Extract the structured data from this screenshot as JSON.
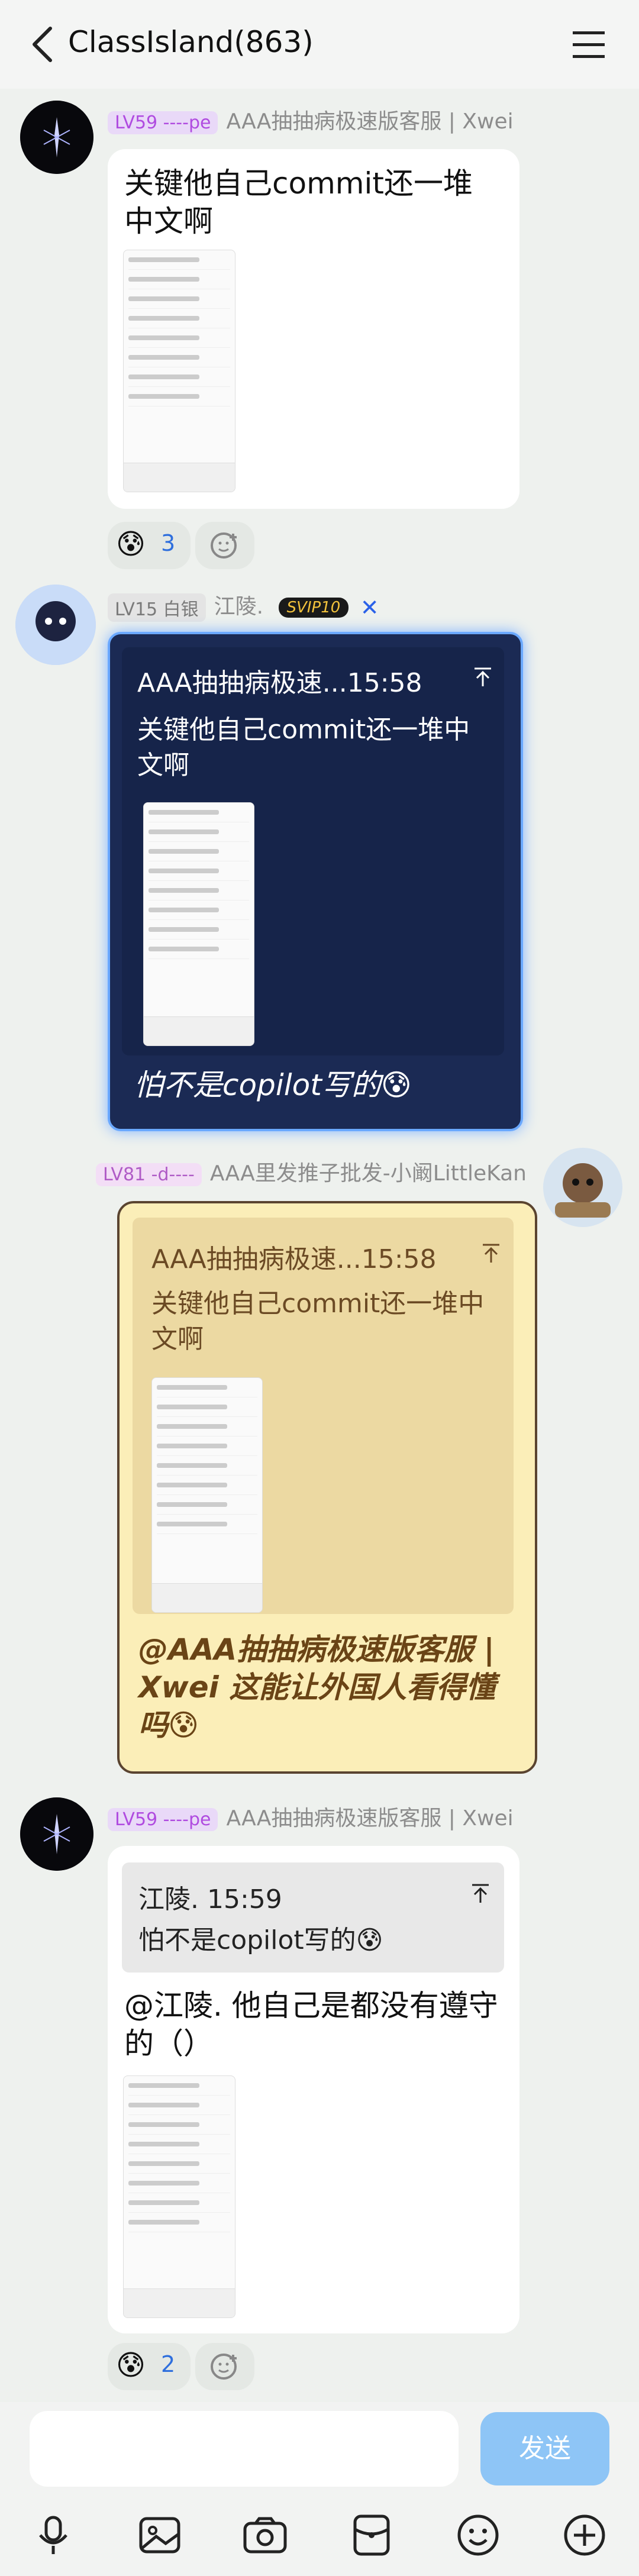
{
  "header": {
    "title": "ClassIsland(863)"
  },
  "messages": [
    {
      "badge": "LV59 ----pe",
      "name": "AAA抽抽病极速版客服 | Xwei",
      "text": "关键他自己commit还一堆中文啊",
      "reaction_emoji": "😰",
      "reaction_count": "3"
    },
    {
      "badge": "LV15 白银",
      "name": "江陵.",
      "vip": "SVIP10",
      "quote_title": "AAA抽抽病极速...15:58",
      "quote_text": "关键他自己commit还一堆中文啊",
      "text": "怕不是copilot写的😰"
    },
    {
      "badge": "LV81 -d----",
      "name": "AAA里发推子批发-小阚LittleKan",
      "quote_title": "AAA抽抽病极速...15:58",
      "quote_text": "关键他自己commit还一堆中文啊",
      "text": "@AAA抽抽病极速版客服 | Xwei 这能让外国人看得懂吗😰"
    },
    {
      "badge": "LV59 ----pe",
      "name": "AAA抽抽病极速版客服 | Xwei",
      "quote_title": "江陵. 15:59",
      "quote_text": "怕不是copilot写的😰",
      "text": "@江陵. 他自己是都没有遵守的（）",
      "reaction_emoji": "😰",
      "reaction_count": "2"
    }
  ],
  "input": {
    "send_label": "发送"
  }
}
